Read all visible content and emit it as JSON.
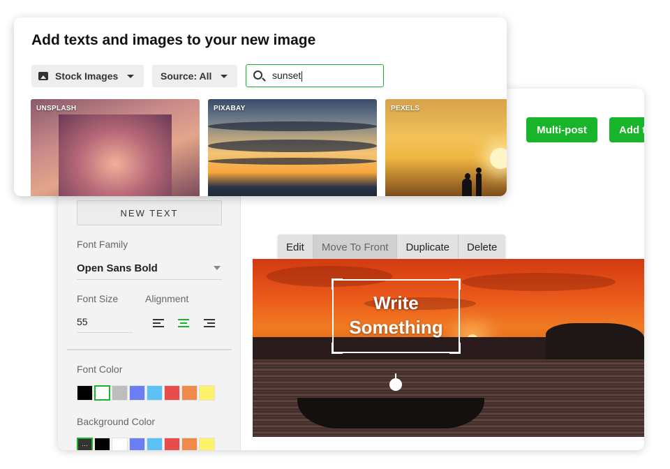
{
  "stock_panel": {
    "title": "Add texts and images to your new image",
    "stock_dropdown": "Stock Images",
    "source_dropdown": "Source: All",
    "search_value": "sunset",
    "thumbnails": [
      {
        "source": "UNSPLASH"
      },
      {
        "source": "PIXABAY"
      },
      {
        "source": "PEXELS"
      }
    ]
  },
  "header_buttons": {
    "multipost": "Multi-post",
    "add": "Add t"
  },
  "sidebar": {
    "new_text": "NEW TEXT",
    "font_family_label": "Font Family",
    "font_family_value": "Open Sans Bold",
    "font_size_label": "Font Size",
    "font_size_value": "55",
    "alignment_label": "Alignment",
    "font_color_label": "Font Color",
    "background_color_label": "Background Color",
    "font_colors": [
      "#000000",
      "#ffffff",
      "#bdbdbd",
      "#6b7ff2",
      "#5bc2f5",
      "#e84c4c",
      "#ef8a4a",
      "#fdf36a"
    ],
    "background_colors": [
      "#333333",
      "#000000",
      "#ffffff",
      "#6b7ff2",
      "#5bc2f5",
      "#e84c4c",
      "#ef8a4a",
      "#fdf36a"
    ]
  },
  "toolbar": {
    "edit": "Edit",
    "move_to_front": "Move To Front",
    "duplicate": "Duplicate",
    "delete": "Delete"
  },
  "canvas": {
    "text_line1": "Write",
    "text_line2": "Something"
  }
}
